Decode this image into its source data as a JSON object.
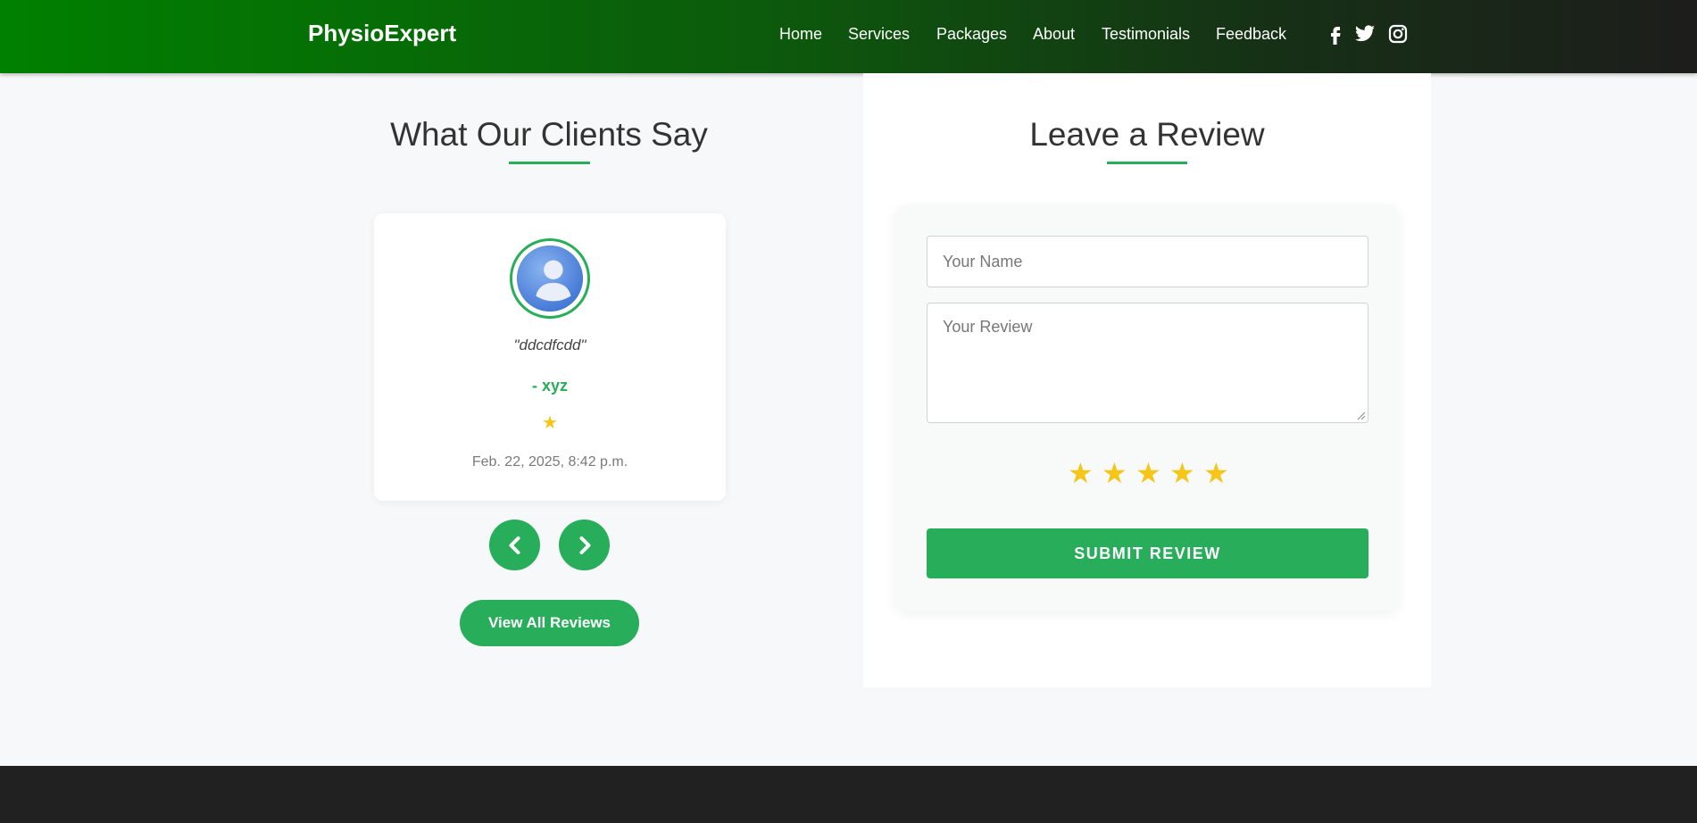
{
  "header": {
    "brand": "PhysioExpert",
    "nav": [
      "Home",
      "Services",
      "Packages",
      "About",
      "Testimonials",
      "Feedback"
    ],
    "social_icons": [
      "facebook-icon",
      "twitter-icon",
      "instagram-icon"
    ]
  },
  "testimonials": {
    "title": "What Our Clients Say",
    "current": {
      "quote": "\"ddcdfcdd\"",
      "author": "- xyz",
      "stars": "★",
      "rating": 1,
      "date": "Feb. 22, 2025, 8:42 p.m."
    },
    "prev_icon": "chevron-left-icon",
    "next_icon": "chevron-right-icon",
    "view_all_label": "View All Reviews"
  },
  "review_form": {
    "title": "Leave a Review",
    "name_placeholder": "Your Name",
    "review_placeholder": "Your Review",
    "rating_stars": [
      "★",
      "★",
      "★",
      "★",
      "★"
    ],
    "submit_label": "SUBMIT REVIEW"
  },
  "colors": {
    "accent": "#28ad5a",
    "star": "#f5c518",
    "header_start": "#008000",
    "header_end": "#1d1d1b",
    "footer": "#212121"
  }
}
